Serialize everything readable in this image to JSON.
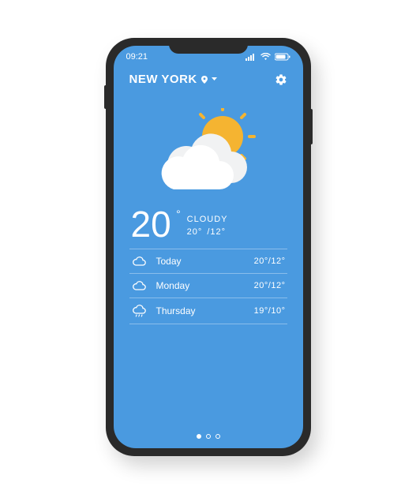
{
  "status": {
    "time": "09:21"
  },
  "header": {
    "city": "NEW YORK"
  },
  "current": {
    "temp": "20",
    "condition": "CLOUDY",
    "high": "20°",
    "low": "/12°"
  },
  "forecast": [
    {
      "day": "Today",
      "high": "20°",
      "low": "/12°",
      "icon": "cloud"
    },
    {
      "day": "Monday",
      "high": "20°",
      "low": "/12°",
      "icon": "cloud"
    },
    {
      "day": "Thursday",
      "high": "19°",
      "low": "/10°",
      "icon": "rain"
    }
  ]
}
